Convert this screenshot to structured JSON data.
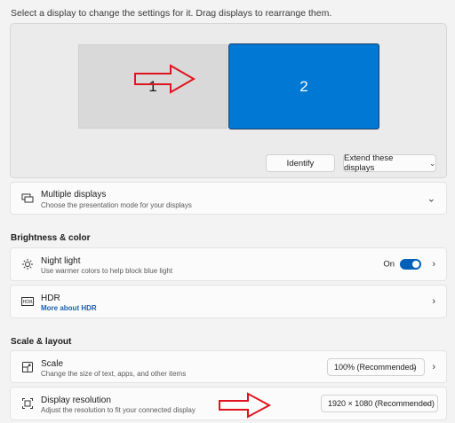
{
  "hint": "Select a display to change the settings for it. Drag displays to rearrange them.",
  "displays": [
    {
      "number": "1"
    },
    {
      "number": "2"
    }
  ],
  "buttons": {
    "identify": "Identify",
    "extend": "Extend these displays"
  },
  "multiple_displays": {
    "title": "Multiple displays",
    "subtitle": "Choose the presentation mode for your displays"
  },
  "brightness_section": "Brightness & color",
  "night_light": {
    "title": "Night light",
    "subtitle": "Use warmer colors to help block blue light",
    "state": "On"
  },
  "hdr": {
    "title": "HDR",
    "link": "More about HDR"
  },
  "scale_section": "Scale & layout",
  "scale": {
    "title": "Scale",
    "subtitle": "Change the size of text, apps, and other items",
    "value": "100% (Recommended)"
  },
  "resolution": {
    "title": "Display resolution",
    "subtitle": "Adjust the resolution to fit your connected display",
    "value": "1920 × 1080 (Recommended)"
  },
  "colors": {
    "accent": "#0078d4",
    "annotation_arrow": "#e0141e"
  }
}
